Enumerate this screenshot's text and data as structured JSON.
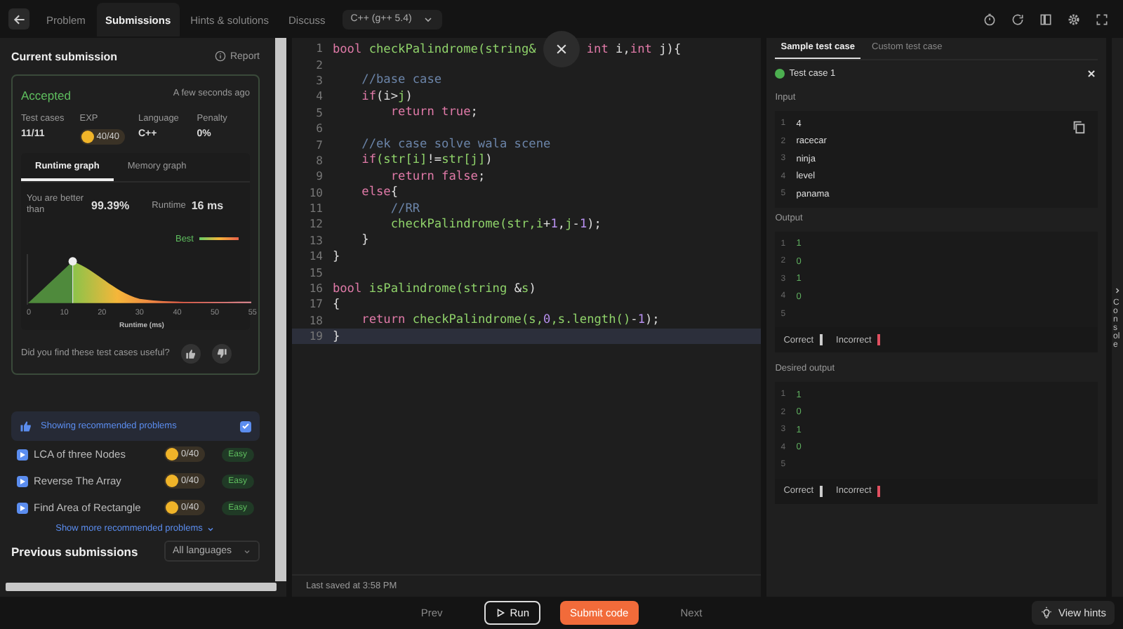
{
  "nav": {
    "tabs": [
      {
        "label": "Problem",
        "selected": false
      },
      {
        "label": "Submissions",
        "selected": true
      },
      {
        "label": "Hints & solutions",
        "selected": false
      },
      {
        "label": "Discuss",
        "selected": false
      }
    ],
    "language": "C++ (g++ 5.4)"
  },
  "submission": {
    "title": "Current submission",
    "report": "Report",
    "status": "Accepted",
    "time": "A few seconds ago",
    "stats": [
      {
        "label": "Test cases",
        "value": "11/11",
        "kind": "text"
      },
      {
        "label": "EXP",
        "value": "40/40",
        "kind": "coin"
      },
      {
        "label": "Language",
        "value": "C++",
        "kind": "text"
      },
      {
        "label": "Penalty",
        "value": "0%",
        "kind": "text"
      }
    ],
    "graph_tabs": [
      {
        "label": "Runtime graph",
        "selected": true
      },
      {
        "label": "Memory graph",
        "selected": false
      }
    ],
    "better_label": "You are better than",
    "better_value": "99.39%",
    "runtime_label": "Runtime",
    "runtime_value": "16 ms",
    "legend": "Best",
    "x_ticks": [
      "0",
      "10",
      "20",
      "30",
      "40",
      "50",
      "55"
    ],
    "xlabel": "Runtime (ms)",
    "feedback": "Did you find these test cases useful?"
  },
  "recommended": {
    "banner": "Showing recommended problems",
    "checked": true,
    "items": [
      {
        "title": "LCA of three Nodes",
        "exp": "0/40",
        "difficulty": "Easy"
      },
      {
        "title": "Reverse The Array",
        "exp": "0/40",
        "difficulty": "Easy"
      },
      {
        "title": "Find Area of Rectangle",
        "exp": "0/40",
        "difficulty": "Easy"
      }
    ],
    "more": "Show more recommended problems"
  },
  "previous": {
    "title": "Previous submissions",
    "filter": "All languages"
  },
  "editor": {
    "lines": [
      {
        "n": "1",
        "current": false,
        "tokens": [
          {
            "kind": "kw",
            "text": "bool"
          },
          {
            "kind": "fn",
            "text": " checkPalindrome(string&"
          },
          {
            "kind": "close"
          },
          {
            "kind": "kw",
            "text": "int"
          },
          {
            "kind": "tx",
            "text": " i,"
          },
          {
            "kind": "kw",
            "text": "int"
          },
          {
            "kind": "tx",
            "text": " j){"
          }
        ]
      },
      {
        "n": "2",
        "current": false
      },
      {
        "n": "3",
        "current": false,
        "tokens": [
          {
            "kind": "cm",
            "text": "    //base case"
          }
        ]
      },
      {
        "n": "4",
        "current": false,
        "tokens": [
          {
            "kind": "kw",
            "text": "    if"
          },
          {
            "kind": "tx",
            "text": "(i>"
          },
          {
            "kind": "fn",
            "text": "j"
          },
          {
            "kind": "tx",
            "text": ")"
          }
        ]
      },
      {
        "n": "5",
        "current": false,
        "tokens": [
          {
            "kind": "kw",
            "text": "        return true"
          },
          {
            "kind": "tx",
            "text": ";"
          }
        ]
      },
      {
        "n": "6",
        "current": false
      },
      {
        "n": "7",
        "current": false,
        "tokens": [
          {
            "kind": "cm",
            "text": "    //ek case solve wala scene"
          }
        ]
      },
      {
        "n": "8",
        "current": false,
        "tokens": [
          {
            "kind": "kw",
            "text": "    if"
          },
          {
            "kind": "fn",
            "text": "(str[i]"
          },
          {
            "kind": "tx",
            "text": "!="
          },
          {
            "kind": "fn",
            "text": "str[j]"
          },
          {
            "kind": "tx",
            "text": ")"
          }
        ]
      },
      {
        "n": "9",
        "current": false,
        "tokens": [
          {
            "kind": "kw",
            "text": "        return false"
          },
          {
            "kind": "tx",
            "text": ";"
          }
        ]
      },
      {
        "n": "10",
        "current": false,
        "tokens": [
          {
            "kind": "kw",
            "text": "    else"
          },
          {
            "kind": "tx",
            "text": "{"
          }
        ]
      },
      {
        "n": "11",
        "current": false,
        "tokens": [
          {
            "kind": "cm",
            "text": "        //RR"
          }
        ]
      },
      {
        "n": "12",
        "current": false,
        "tokens": [
          {
            "kind": "fn",
            "text": "        checkPalindrome(str,i"
          },
          {
            "kind": "tx",
            "text": "+"
          },
          {
            "kind": "num",
            "text": "1"
          },
          {
            "kind": "tx",
            "text": ","
          },
          {
            "kind": "fn",
            "text": "j"
          },
          {
            "kind": "tx",
            "text": "-"
          },
          {
            "kind": "num",
            "text": "1"
          },
          {
            "kind": "tx",
            "text": ");"
          }
        ]
      },
      {
        "n": "13",
        "current": false,
        "tokens": [
          {
            "kind": "tx",
            "text": "    }"
          }
        ]
      },
      {
        "n": "14",
        "current": false,
        "tokens": [
          {
            "kind": "tx",
            "text": "}"
          }
        ]
      },
      {
        "n": "15",
        "current": false
      },
      {
        "n": "16",
        "current": false,
        "tokens": [
          {
            "kind": "kw",
            "text": "bool"
          },
          {
            "kind": "fn",
            "text": " isPalindrome(string"
          },
          {
            "kind": "tx",
            "text": " &"
          },
          {
            "kind": "fn",
            "text": "s"
          },
          {
            "kind": "tx",
            "text": ")"
          }
        ]
      },
      {
        "n": "17",
        "current": false,
        "tokens": [
          {
            "kind": "tx",
            "text": "{"
          }
        ]
      },
      {
        "n": "18",
        "current": false,
        "tokens": [
          {
            "kind": "kw",
            "text": "    return"
          },
          {
            "kind": "fn",
            "text": " checkPalindrome(s,"
          },
          {
            "kind": "num",
            "text": "0"
          },
          {
            "kind": "fn",
            "text": ",s.length()"
          },
          {
            "kind": "tx",
            "text": "-"
          },
          {
            "kind": "num",
            "text": "1"
          },
          {
            "kind": "tx",
            "text": ");"
          }
        ]
      },
      {
        "n": "19",
        "current": true,
        "tokens": [
          {
            "kind": "tx",
            "text": "}"
          }
        ]
      }
    ],
    "status": "Last saved at 3:58 PM"
  },
  "tests": {
    "tabs": [
      {
        "label": "Sample test case",
        "selected": true
      },
      {
        "label": "Custom test case",
        "selected": false
      }
    ],
    "case": "Test case 1",
    "sections": [
      {
        "title": "Input",
        "kind": "input",
        "lines": [
          {
            "n": "1",
            "text": "4"
          },
          {
            "n": "2",
            "text": "racecar"
          },
          {
            "n": "3",
            "text": "ninja"
          },
          {
            "n": "4",
            "text": "level"
          },
          {
            "n": "5",
            "text": "panama"
          }
        ]
      },
      {
        "title": "Output",
        "kind": "output",
        "lines": [
          {
            "n": "1",
            "text": "1"
          },
          {
            "n": "2",
            "text": "0"
          },
          {
            "n": "3",
            "text": "1"
          },
          {
            "n": "4",
            "text": "0"
          },
          {
            "n": "5"
          }
        ],
        "correct": "Correct",
        "incorrect": "Incorrect"
      },
      {
        "title": "Desired output",
        "kind": "output",
        "lines": [
          {
            "n": "1",
            "text": "1"
          },
          {
            "n": "2",
            "text": "0"
          },
          {
            "n": "3",
            "text": "1"
          },
          {
            "n": "4",
            "text": "0"
          },
          {
            "n": "5"
          }
        ],
        "correct": "Correct",
        "incorrect": "Incorrect"
      }
    ]
  },
  "console": "Console",
  "footer": {
    "prev": "Prev",
    "run": "Run",
    "submit": "Submit code",
    "next": "Next",
    "hints": "View hints"
  }
}
